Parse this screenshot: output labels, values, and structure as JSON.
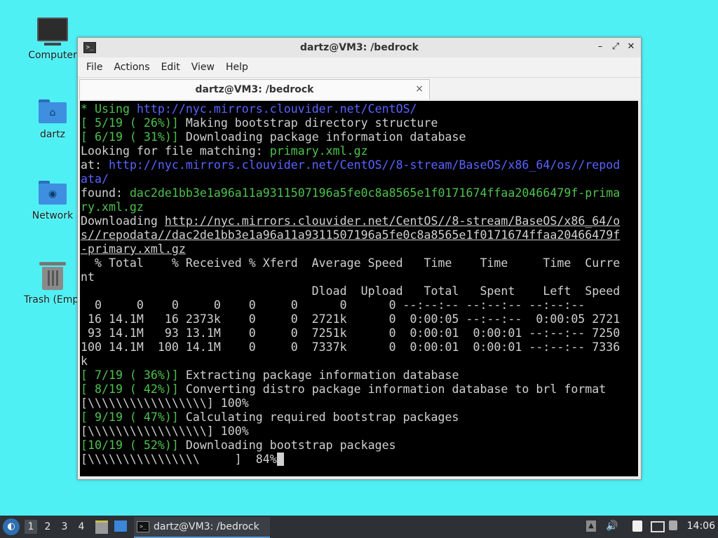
{
  "desktop": {
    "icons": [
      {
        "label": "Computer"
      },
      {
        "label": "dartz"
      },
      {
        "label": "Network"
      },
      {
        "label": "Trash (Empty)"
      }
    ]
  },
  "window": {
    "title": "dartz@VM3: /bedrock",
    "controls": {
      "minimize": "–",
      "maximize": "⤢",
      "close": "✕"
    },
    "menu": [
      "File",
      "Actions",
      "Edit",
      "View",
      "Help"
    ],
    "tab": {
      "label": "dartz@VM3: /bedrock",
      "close": "×"
    }
  },
  "terminal": {
    "lines": [
      [
        {
          "t": "* Using ",
          "c": "g"
        },
        {
          "t": "http://nyc.mirrors.clouvider.net/CentOS/",
          "c": "b"
        }
      ],
      [
        {
          "t": "[ 5/19 ( 26%)]",
          "c": "g"
        },
        {
          "t": " Making bootstrap directory structure"
        }
      ],
      [
        {
          "t": "[ 6/19 ( 31%)]",
          "c": "g"
        },
        {
          "t": " Downloading package information database"
        }
      ],
      [
        {
          "t": "Looking for file matching: "
        },
        {
          "t": "primary.xml.gz",
          "c": "g"
        }
      ],
      [
        {
          "t": "at: "
        },
        {
          "t": "http://nyc.mirrors.clouvider.net/CentOS//8-stream/BaseOS/x86_64/os//repod",
          "c": "b"
        }
      ],
      [
        {
          "t": "ata/",
          "c": "b"
        }
      ],
      [
        {
          "t": "found: "
        },
        {
          "t": "dac2de1bb3e1a96a11a9311507196a5fe0c8a8565e1f0171674ffaa20466479f-prima",
          "c": "g"
        }
      ],
      [
        {
          "t": "ry.xml.gz",
          "c": "g"
        }
      ],
      [
        {
          "t": "Downloading "
        },
        {
          "t": "http://nyc.mirrors.clouvider.net/CentOS//8-stream/BaseOS/x86_64/o",
          "c": "u"
        }
      ],
      [
        {
          "t": "s//repodata//dac2de1bb3e1a96a11a9311507196a5fe0c8a8565e1f0171674ffaa20466479f",
          "c": "u"
        }
      ],
      [
        {
          "t": "-primary.xml.gz",
          "c": "u"
        }
      ],
      [
        {
          "t": "  % Total    % Received % Xferd  Average Speed   Time    Time     Time  Curre"
        }
      ],
      [
        {
          "t": "nt"
        }
      ],
      [
        {
          "t": "                                 Dload  Upload   Total   Spent    Left  Speed"
        }
      ],
      [
        {
          "t": "  0     0    0     0    0     0      0      0 --:--:-- --:--:-- --:--:--"
        }
      ],
      [
        {
          "t": " 16 14.1M   16 2373k    0     0  2721k      0  0:00:05 --:--:--  0:00:05 2721"
        }
      ],
      [
        {
          "t": " 93 14.1M   93 13.1M    0     0  7251k      0  0:00:01  0:00:01 --:--:-- 7250"
        }
      ],
      [
        {
          "t": "100 14.1M  100 14.1M    0     0  7337k      0  0:00:01  0:00:01 --:--:-- 7336"
        }
      ],
      [
        {
          "t": "k"
        }
      ],
      [
        {
          "t": "[ 7/19 ( 36%)]",
          "c": "g"
        },
        {
          "t": " Extracting package information database"
        }
      ],
      [
        {
          "t": "[ 8/19 ( 42%)]",
          "c": "g"
        },
        {
          "t": " Converting distro package information database to brl format"
        }
      ],
      [
        {
          "t": "[\\\\\\\\\\\\\\\\\\\\\\\\\\\\\\\\\\] 100%"
        }
      ],
      [
        {
          "t": "[ 9/19 ( 47%)]",
          "c": "g"
        },
        {
          "t": " Calculating required bootstrap packages"
        }
      ],
      [
        {
          "t": "[\\\\\\\\\\\\\\\\\\\\\\\\\\\\\\\\\\] 100%"
        }
      ],
      [
        {
          "t": "[10/19 ( 52%)]",
          "c": "g"
        },
        {
          "t": " Downloading bootstrap packages"
        }
      ],
      [
        {
          "t": "[\\\\\\\\\\\\\\\\\\\\\\\\\\\\\\\\     ]  84%"
        },
        {
          "t": " ",
          "c": "cursor"
        }
      ]
    ]
  },
  "taskbar": {
    "start_icon": "start-menu-icon",
    "workspaces": [
      "1",
      "2",
      "3",
      "4"
    ],
    "active_workspace": "1",
    "task_label": "dartz@VM3: /bedrock",
    "clock": "14:06"
  }
}
